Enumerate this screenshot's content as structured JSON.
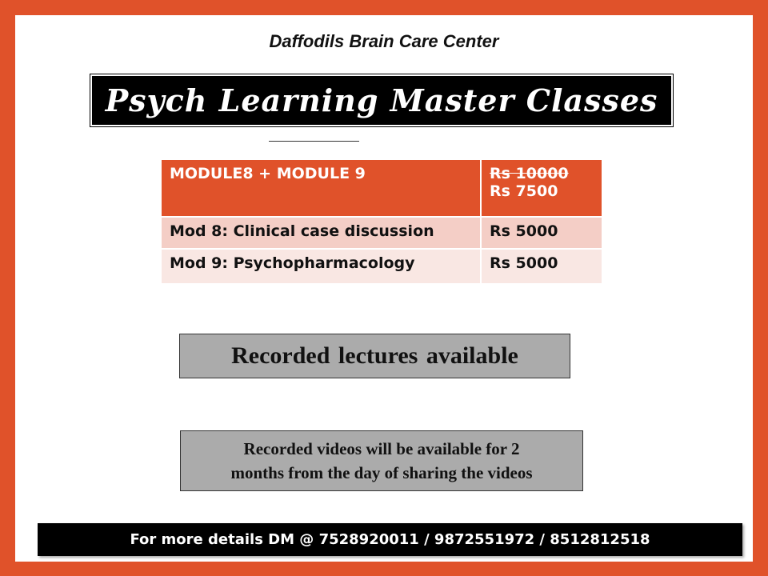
{
  "org_name": "Daffodils Brain Care Center",
  "title": "Psych Learning Master Classes",
  "price_table": {
    "header": {
      "label": "MODULE8  + MODULE 9",
      "old_price": "Rs 10000",
      "new_price": "Rs 7500"
    },
    "rows": [
      {
        "label": "Mod 8: Clinical case discussion",
        "price": "Rs 5000"
      },
      {
        "label": "Mod 9: Psychopharmacology",
        "price": "Rs 5000"
      }
    ]
  },
  "recorded_banner": "Recorded lectures available",
  "validity_note": {
    "line1": "Recorded videos will be available for 2",
    "line2": "months from the day of  sharing the videos"
  },
  "footer_contact": "For more details DM @ 7528920011  / 9872551972 /  8512812518",
  "colors": {
    "accent": "#e0522a",
    "row_light": "#f4cec6",
    "row_lighter": "#f9e7e3",
    "gray_box": "#ababab",
    "dark": "#000000"
  }
}
